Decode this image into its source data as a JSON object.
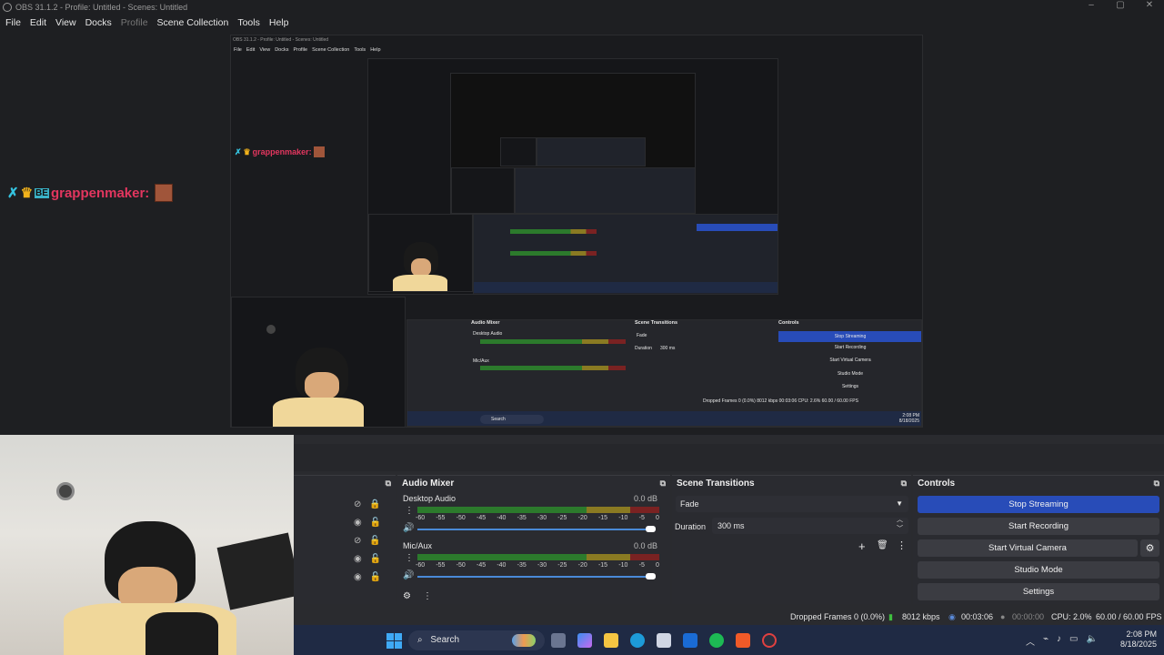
{
  "window": {
    "title": "OBS 31.1.2 - Profile: Untitled - Scenes: Untitled",
    "minimize": "–",
    "restore": "▢",
    "close": "✕"
  },
  "menu": {
    "items": [
      "File",
      "Edit",
      "View",
      "Docks",
      "Profile",
      "Scene Collection",
      "Tools",
      "Help"
    ]
  },
  "nested": {
    "title": "OBS 31.1.2 - Profile: Untitled - Scenes: Untitled",
    "menu": [
      "File",
      "Edit",
      "View",
      "Docks",
      "Profile",
      "Scene Collection",
      "Tools",
      "Help"
    ],
    "chat_user": "grappenmaker:",
    "mixer_title": "Audio Mixer",
    "desktop_audio": "Desktop Audio",
    "mic_aux": "Mic/Aux",
    "transitions_title": "Scene Transitions",
    "fade": "Fade",
    "duration_label": "Duration",
    "duration_value": "300 ms",
    "controls_title": "Controls",
    "stop_streaming": "Stop Streaming",
    "start_recording": "Start Recording",
    "start_virtual_camera": "Start Virtual Camera",
    "studio_mode": "Studio Mode",
    "settings": "Settings",
    "status": "Dropped Frames 0 (0.0%)   8012 kbps   00:03:06   CPU: 2.6%   60.00 / 60.00 FPS",
    "search": "Search",
    "time": "2:08 PM",
    "date": "8/18/2025"
  },
  "chat": {
    "username": "grappenmaker:"
  },
  "audio_mixer": {
    "title": "Audio Mixer",
    "channels": [
      {
        "name": "Desktop Audio",
        "level": "0.0 dB"
      },
      {
        "name": "Mic/Aux",
        "level": "0.0 dB"
      }
    ],
    "scale": [
      "-60",
      "-55",
      "-50",
      "-45",
      "-40",
      "-35",
      "-30",
      "-25",
      "-20",
      "-15",
      "-10",
      "-5",
      "0"
    ]
  },
  "scene_transitions": {
    "title": "Scene Transitions",
    "transition": "Fade",
    "duration_label": "Duration",
    "duration_value": "300 ms"
  },
  "controls": {
    "title": "Controls",
    "stop_streaming": "Stop Streaming",
    "start_recording": "Start Recording",
    "start_virtual_camera": "Start Virtual Camera",
    "studio_mode": "Studio Mode",
    "settings": "Settings"
  },
  "status_bar": {
    "dropped_frames": "Dropped Frames 0 (0.0%)",
    "bitrate": "8012 kbps",
    "stream_time": "00:03:06",
    "record_time": "00:00:00",
    "cpu": "CPU: 2.0%",
    "fps": "60.00 / 60.00 FPS"
  },
  "taskbar": {
    "search": "Search",
    "time": "2:08 PM",
    "date": "8/18/2025"
  },
  "colors": {
    "accent": "#284cb8",
    "chat_name": "#e3365f"
  }
}
